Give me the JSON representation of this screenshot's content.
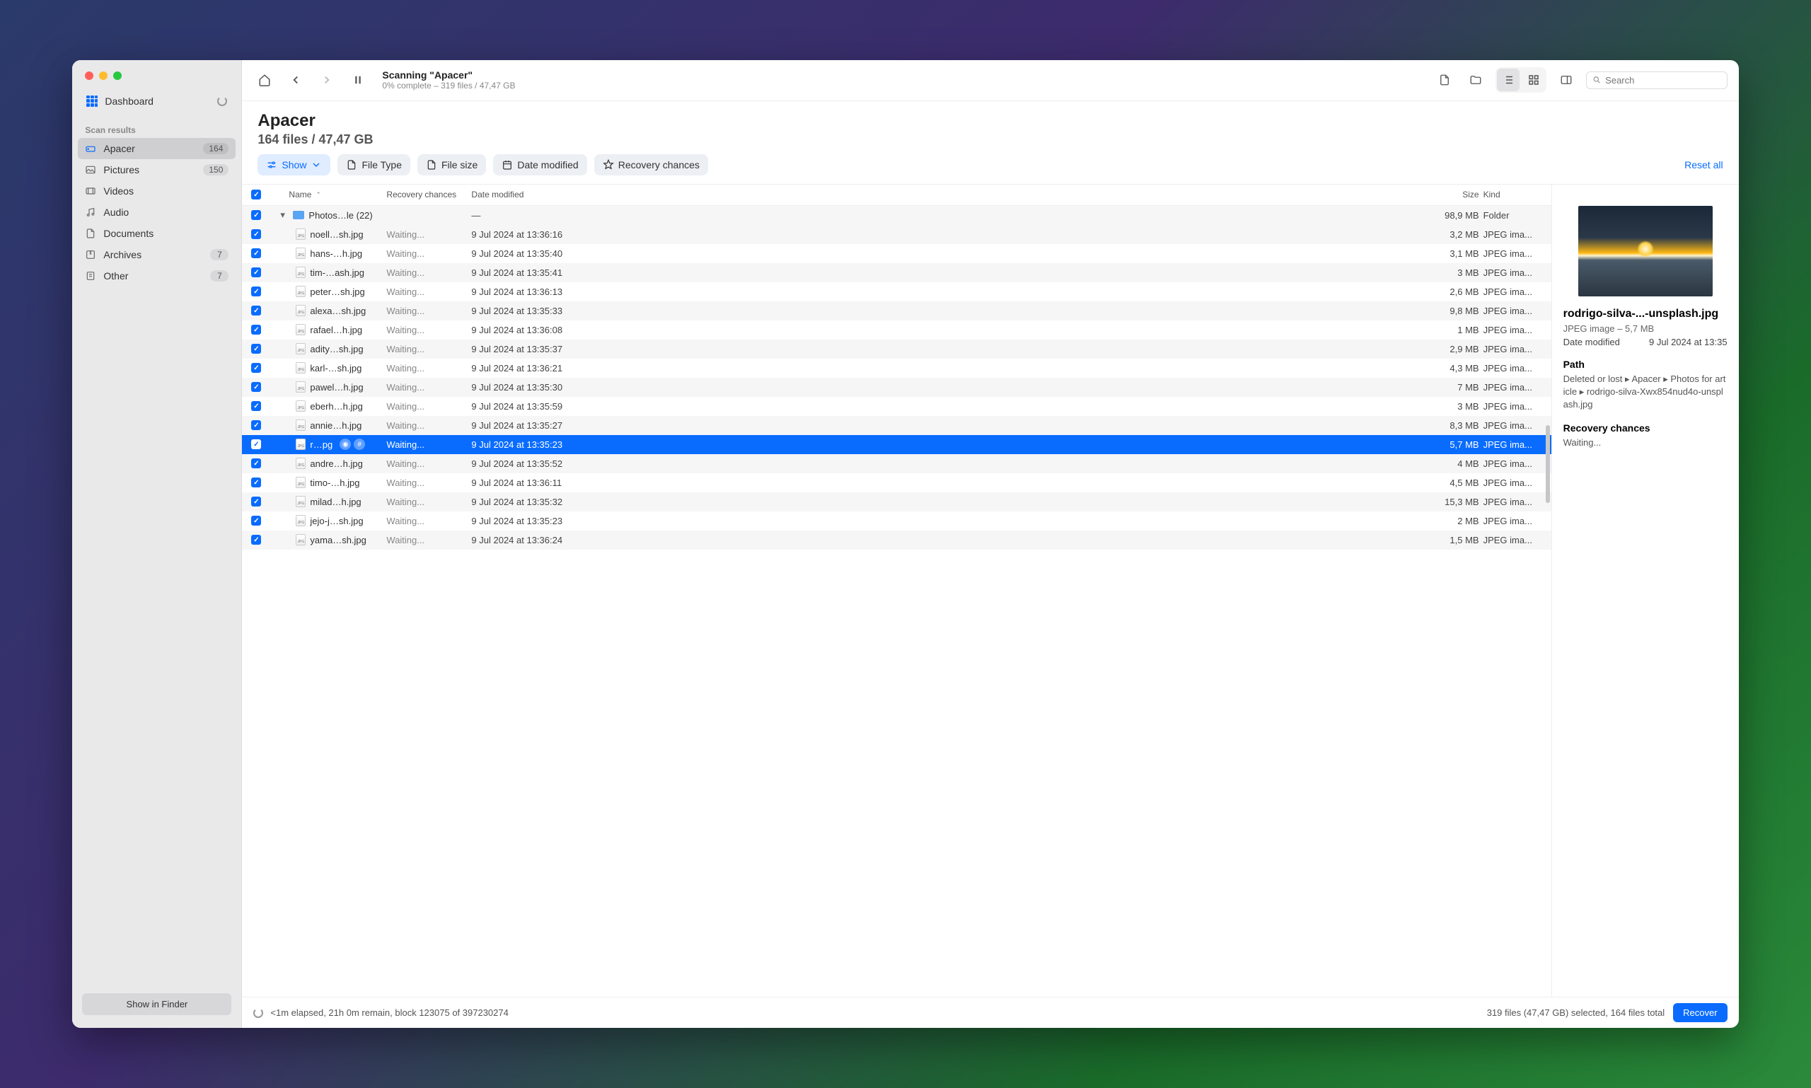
{
  "sidebar": {
    "dashboard_label": "Dashboard",
    "section_title": "Scan results",
    "items": [
      {
        "label": "Apacer",
        "badge": "164",
        "icon": "drive",
        "active": true
      },
      {
        "label": "Pictures",
        "badge": "150",
        "icon": "picture"
      },
      {
        "label": "Videos",
        "badge": "",
        "icon": "video"
      },
      {
        "label": "Audio",
        "badge": "",
        "icon": "audio"
      },
      {
        "label": "Documents",
        "badge": "",
        "icon": "document"
      },
      {
        "label": "Archives",
        "badge": "7",
        "icon": "archive"
      },
      {
        "label": "Other",
        "badge": "7",
        "icon": "other"
      }
    ],
    "show_in_finder": "Show in Finder"
  },
  "toolbar": {
    "scan_title": "Scanning \"Apacer\"",
    "scan_sub": "0% complete – 319 files / 47,47 GB",
    "search_placeholder": "Search"
  },
  "header": {
    "title": "Apacer",
    "subtitle": "164 files / 47,47 GB"
  },
  "filters": {
    "show": "Show",
    "file_type": "File Type",
    "file_size": "File size",
    "date_modified": "Date modified",
    "recovery": "Recovery chances",
    "reset": "Reset all"
  },
  "columns": {
    "name": "Name",
    "recovery": "Recovery chances",
    "date": "Date modified",
    "size": "Size",
    "kind": "Kind"
  },
  "group": {
    "name": "Photos…le (22)",
    "date": "—",
    "size": "98,9 MB",
    "kind": "Folder"
  },
  "rows": [
    {
      "name": "noell…sh.jpg",
      "rec": "Waiting...",
      "date": "9 Jul 2024 at 13:36:16",
      "size": "3,2 MB",
      "kind": "JPEG ima..."
    },
    {
      "name": "hans-…h.jpg",
      "rec": "Waiting...",
      "date": "9 Jul 2024 at 13:35:40",
      "size": "3,1 MB",
      "kind": "JPEG ima..."
    },
    {
      "name": "tim-…ash.jpg",
      "rec": "Waiting...",
      "date": "9 Jul 2024 at 13:35:41",
      "size": "3 MB",
      "kind": "JPEG ima..."
    },
    {
      "name": "peter…sh.jpg",
      "rec": "Waiting...",
      "date": "9 Jul 2024 at 13:36:13",
      "size": "2,6 MB",
      "kind": "JPEG ima..."
    },
    {
      "name": "alexa…sh.jpg",
      "rec": "Waiting...",
      "date": "9 Jul 2024 at 13:35:33",
      "size": "9,8 MB",
      "kind": "JPEG ima..."
    },
    {
      "name": "rafael…h.jpg",
      "rec": "Waiting...",
      "date": "9 Jul 2024 at 13:36:08",
      "size": "1 MB",
      "kind": "JPEG ima..."
    },
    {
      "name": "adity…sh.jpg",
      "rec": "Waiting...",
      "date": "9 Jul 2024 at 13:35:37",
      "size": "2,9 MB",
      "kind": "JPEG ima..."
    },
    {
      "name": "karl-…sh.jpg",
      "rec": "Waiting...",
      "date": "9 Jul 2024 at 13:36:21",
      "size": "4,3 MB",
      "kind": "JPEG ima..."
    },
    {
      "name": "pawel…h.jpg",
      "rec": "Waiting...",
      "date": "9 Jul 2024 at 13:35:30",
      "size": "7 MB",
      "kind": "JPEG ima..."
    },
    {
      "name": "eberh…h.jpg",
      "rec": "Waiting...",
      "date": "9 Jul 2024 at 13:35:59",
      "size": "3 MB",
      "kind": "JPEG ima..."
    },
    {
      "name": "annie…h.jpg",
      "rec": "Waiting...",
      "date": "9 Jul 2024 at 13:35:27",
      "size": "8,3 MB",
      "kind": "JPEG ima..."
    },
    {
      "name": "r…pg",
      "rec": "Waiting...",
      "date": "9 Jul 2024 at 13:35:23",
      "size": "5,7 MB",
      "kind": "JPEG ima...",
      "selected": true
    },
    {
      "name": "andre…h.jpg",
      "rec": "Waiting...",
      "date": "9 Jul 2024 at 13:35:52",
      "size": "4 MB",
      "kind": "JPEG ima..."
    },
    {
      "name": "timo-…h.jpg",
      "rec": "Waiting...",
      "date": "9 Jul 2024 at 13:36:11",
      "size": "4,5 MB",
      "kind": "JPEG ima..."
    },
    {
      "name": "milad…h.jpg",
      "rec": "Waiting...",
      "date": "9 Jul 2024 at 13:35:32",
      "size": "15,3 MB",
      "kind": "JPEG ima..."
    },
    {
      "name": "jejo-j…sh.jpg",
      "rec": "Waiting...",
      "date": "9 Jul 2024 at 13:35:23",
      "size": "2 MB",
      "kind": "JPEG ima..."
    },
    {
      "name": "yama…sh.jpg",
      "rec": "Waiting...",
      "date": "9 Jul 2024 at 13:36:24",
      "size": "1,5 MB",
      "kind": "JPEG ima..."
    }
  ],
  "detail": {
    "filename": "rodrigo-silva-...-unsplash.jpg",
    "meta": "JPEG image – 5,7 MB",
    "date_label": "Date modified",
    "date_value": "9 Jul 2024 at 13:35",
    "path_title": "Path",
    "path": "Deleted or lost ▸ Apacer ▸ Photos for article ▸ rodrigo-silva-Xwx854nud4o-unsplash.jpg",
    "rec_title": "Recovery chances",
    "rec_value": "Waiting..."
  },
  "footer": {
    "status": "<1m elapsed, 21h 0m remain, block 123075 of 397230274",
    "selection": "319 files (47,47 GB) selected, 164 files total",
    "recover": "Recover"
  }
}
